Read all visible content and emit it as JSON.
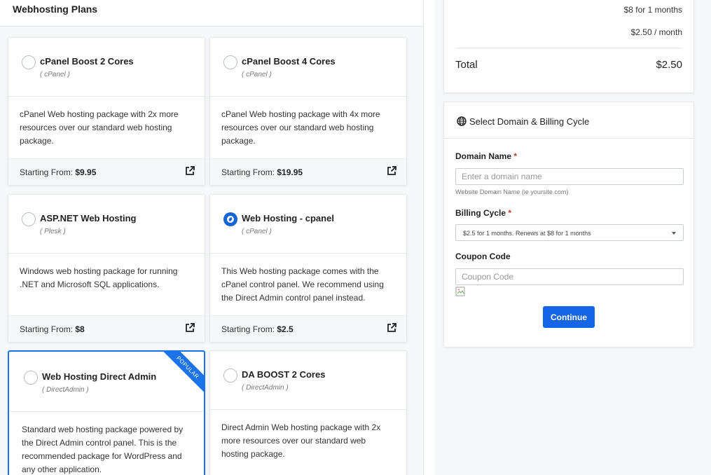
{
  "page": {
    "title": "Webhosting Plans"
  },
  "plans": [
    {
      "name": "cPanel Boost 2 Cores",
      "panel": "( cPanel )",
      "description": "cPanel Web hosting package with 2x more resources over our standard web hosting package.",
      "starting_label": "Starting From:",
      "price": "$9.95",
      "selected": false,
      "popular": false
    },
    {
      "name": "cPanel Boost 4 Cores",
      "panel": "( cPanel )",
      "description": "cPanel Web hosting package with 4x more resources over our standard web hosting package.",
      "starting_label": "Starting From:",
      "price": "$19.95",
      "selected": false,
      "popular": false
    },
    {
      "name": "ASP.NET Web Hosting",
      "panel": "( Plesk )",
      "description": "Windows web hosting package for running .NET and Microsoft SQL applications.",
      "starting_label": "Starting From:",
      "price": "$8",
      "selected": false,
      "popular": false
    },
    {
      "name": "Web Hosting - cpanel",
      "panel": "( cPanel )",
      "description": "This Web hosting package comes with the cPanel control panel. We recommend using the Direct Admin control panel instead.",
      "starting_label": "Starting From:",
      "price": "$2.5",
      "selected": true,
      "popular": false
    },
    {
      "name": "Web Hosting Direct Admin",
      "panel": "( DirectAdmin )",
      "description": "Standard web hosting package powered by the Direct Admin control panel. This is the recommended package for WordPress and any other application.",
      "ribbon": "POPULAR",
      "selected": false,
      "popular": true
    },
    {
      "name": "DA BOOST 2 Cores",
      "panel": "( DirectAdmin )",
      "description": "Direct Admin Web hosting package with 2x more resources over our standard web hosting package.",
      "selected": false,
      "popular": false
    }
  ],
  "summary": {
    "line1": "$8 for 1 months",
    "line2": "$2.50 / month",
    "total_label": "Total",
    "total_value": "$2.50"
  },
  "domain_form": {
    "title": "Select Domain & Billing Cycle",
    "domain_label": "Domain Name",
    "required_mark": "*",
    "domain_placeholder": "Enter a domain name",
    "domain_value": "",
    "domain_help": "Website Domain Name (ie yoursite.com)",
    "billing_label": "Billing Cycle",
    "billing_selected": "$2.5 for 1 months. Renews at $8 for 1 months",
    "coupon_label": "Coupon Code",
    "coupon_placeholder": "Coupon Code",
    "coupon_value": "",
    "continue_label": "Continue"
  },
  "icons": {
    "external_link": "external-link-icon",
    "globe": "globe-icon",
    "broken_image": "broken-image-icon"
  },
  "colors": {
    "accent": "#1565e6",
    "selected_border": "#1a73e8",
    "required": "#c0392b"
  }
}
